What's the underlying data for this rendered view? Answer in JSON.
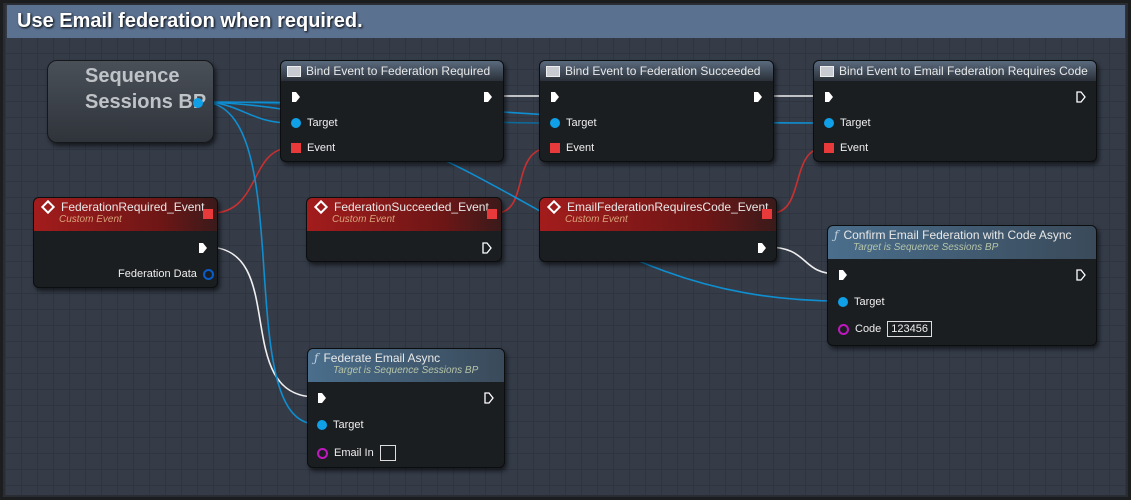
{
  "comment": {
    "title": "Use Email federation when required."
  },
  "variable_node": {
    "label": "Sequence Sessions BP"
  },
  "nodes": {
    "bind_fed_required": {
      "title": "Bind Event to Federation Required",
      "target": "Target",
      "event": "Event"
    },
    "bind_fed_succeeded": {
      "title": "Bind Event to Federation Succeeded",
      "target": "Target",
      "event": "Event"
    },
    "bind_email_code": {
      "title": "Bind Event to Email Federation Requires Code",
      "target": "Target",
      "event": "Event"
    },
    "fed_required_event": {
      "title": "FederationRequired_Event",
      "subtitle": "Custom Event",
      "output": "Federation Data"
    },
    "fed_succeeded_event": {
      "title": "FederationSucceeded_Event",
      "subtitle": "Custom Event"
    },
    "email_code_event": {
      "title": "EmailFederationRequiresCode_Event",
      "subtitle": "Custom Event"
    },
    "confirm_code": {
      "title": "Confirm Email Federation with Code Async",
      "subtitle": "Target is Sequence Sessions BP",
      "target": "Target",
      "code_label": "Code",
      "code_value": "123456"
    },
    "federate_email": {
      "title": "Federate Email Async",
      "subtitle": "Target is Sequence Sessions BP",
      "target": "Target",
      "email_label": "Email In",
      "email_value": ""
    }
  },
  "colors": {
    "object_pin": "#0fa0e8",
    "delegate_pin": "#e83a3a",
    "string_pin": "#c018c0",
    "event_header": "#a31c1c",
    "comment": "#5b7190"
  }
}
